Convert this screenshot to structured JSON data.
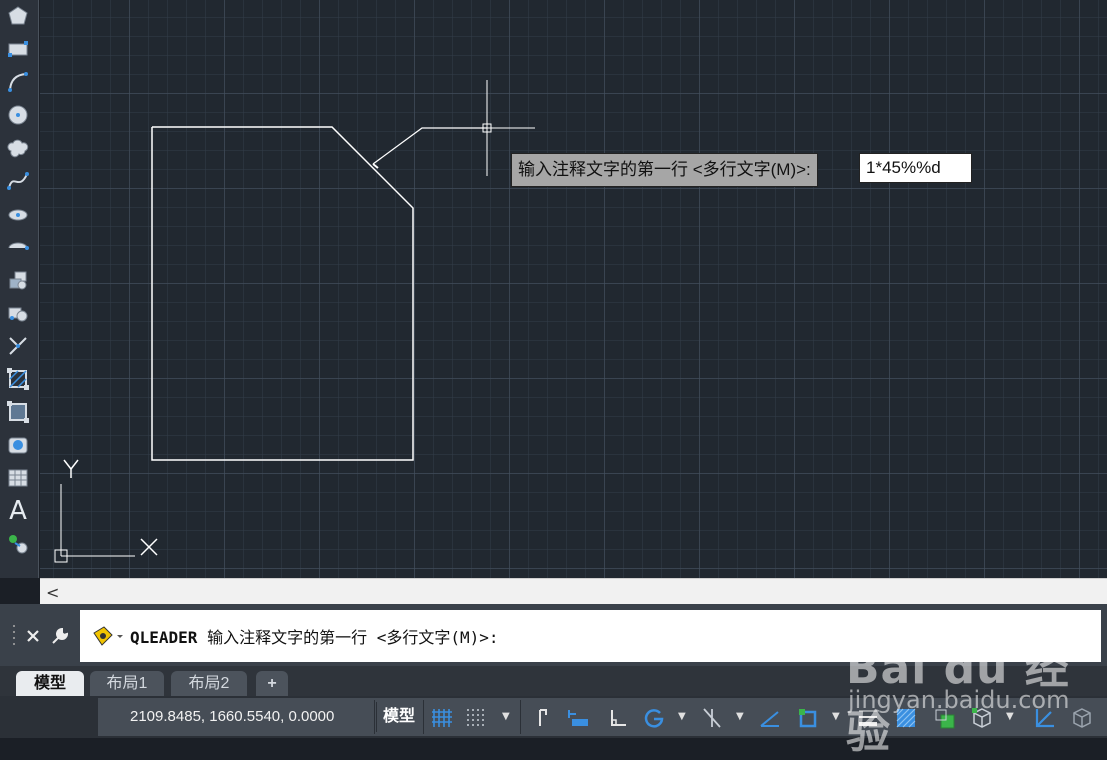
{
  "toolbar": {
    "tools": [
      {
        "name": "polygon-icon"
      },
      {
        "name": "rectangle-icon"
      },
      {
        "name": "arc-icon"
      },
      {
        "name": "circle-icon"
      },
      {
        "name": "revision-cloud-icon"
      },
      {
        "name": "spline-icon"
      },
      {
        "name": "ellipse-icon"
      },
      {
        "name": "ellipse-arc-icon"
      },
      {
        "name": "insert-block-icon"
      },
      {
        "name": "make-block-icon"
      },
      {
        "name": "point-icon"
      },
      {
        "name": "hatch-icon"
      },
      {
        "name": "gradient-icon"
      },
      {
        "name": "region-icon"
      },
      {
        "name": "table-icon"
      },
      {
        "name": "multiline-text-icon",
        "glyph": "A"
      },
      {
        "name": "add-selected-icon"
      }
    ]
  },
  "drawing": {
    "ucs_y_label": "Y",
    "ucs_x_label": "X"
  },
  "prompt": {
    "label": "输入注释文字的第一行 <多行文字(M)>:",
    "input_value": "1*45%%d"
  },
  "scrollbar": {
    "left_arrow": "<"
  },
  "command_line": {
    "command": "QLEADER",
    "text": "输入注释文字的第一行 <多行文字(M)>:"
  },
  "tabs": [
    "模型",
    "布局1",
    "布局2"
  ],
  "add_tab_label": "+",
  "status_bar": {
    "coordinates": "2109.8485, 1660.5540, 0.0000",
    "model_label": "模型"
  },
  "watermark": {
    "brand": "Bai du 经验",
    "url": "jingyan.baidu.com"
  },
  "colors": {
    "canvas_bg": "#212830",
    "accent_blue": "#3a8fe0",
    "geometry_stroke": "#ffffff"
  }
}
